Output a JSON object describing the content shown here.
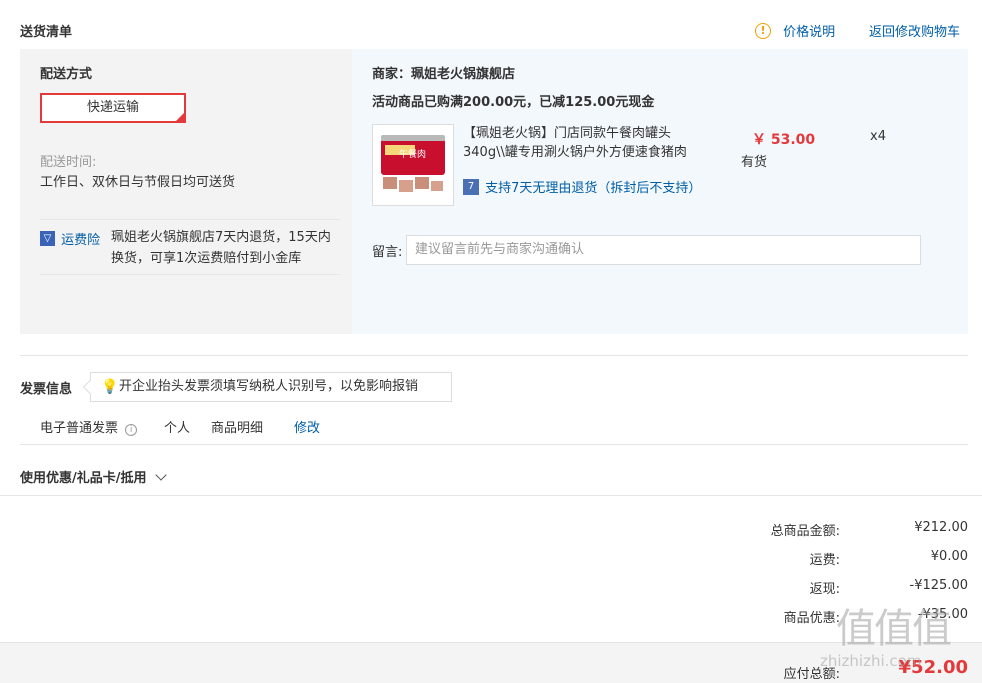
{
  "header": {
    "title": "送货清单",
    "price_info": "价格说明",
    "back_to_cart": "返回修改购物车"
  },
  "delivery": {
    "section_label": "配送方式",
    "method": "快递运输",
    "time_label": "配送时间:",
    "time_value": "工作日、双休日与节假日均可送货",
    "insurance_label": "运费险",
    "insurance_desc": "珮姐老火锅旗舰店7天内退货，15天内换货，可享1次运费赔付到小金库"
  },
  "shop": {
    "merchant_label": "商家：珮姐老火锅旗舰店",
    "promo": "活动商品已购满200.00元，已减125.00元现金",
    "product": {
      "title": "【珮姐老火锅】门店同款午餐肉罐头340g\\\\罐专用涮火锅户外方便速食猪肉",
      "price": "￥ 53.00",
      "stock": "有货",
      "qty": "x4",
      "return_policy": "支持7天无理由退货（拆封后不支持）",
      "img_label": "午餐肉"
    },
    "note_label": "留言:",
    "note_placeholder": "建议留言前先与商家沟通确认"
  },
  "invoice": {
    "title": "发票信息",
    "tip": "开企业抬头发票须填写纳税人识别号，以免影响报销",
    "type": "电子普通发票",
    "holder": "个人",
    "content": "商品明细",
    "edit": "修改"
  },
  "coupons": {
    "label": "使用优惠/礼品卡/抵用"
  },
  "summary": {
    "total_label": "总商品金额:",
    "total_value": "¥212.00",
    "shipping_label": "运费:",
    "shipping_value": "¥0.00",
    "cashback_label": "返现:",
    "cashback_value": "-¥125.00",
    "discount_label": "商品优惠:",
    "discount_value": "-¥35.00",
    "payable_label": "应付总额:",
    "payable_value": "¥52.00"
  },
  "watermark": {
    "text": "值值值",
    "url": "zhizhizhi.com"
  }
}
